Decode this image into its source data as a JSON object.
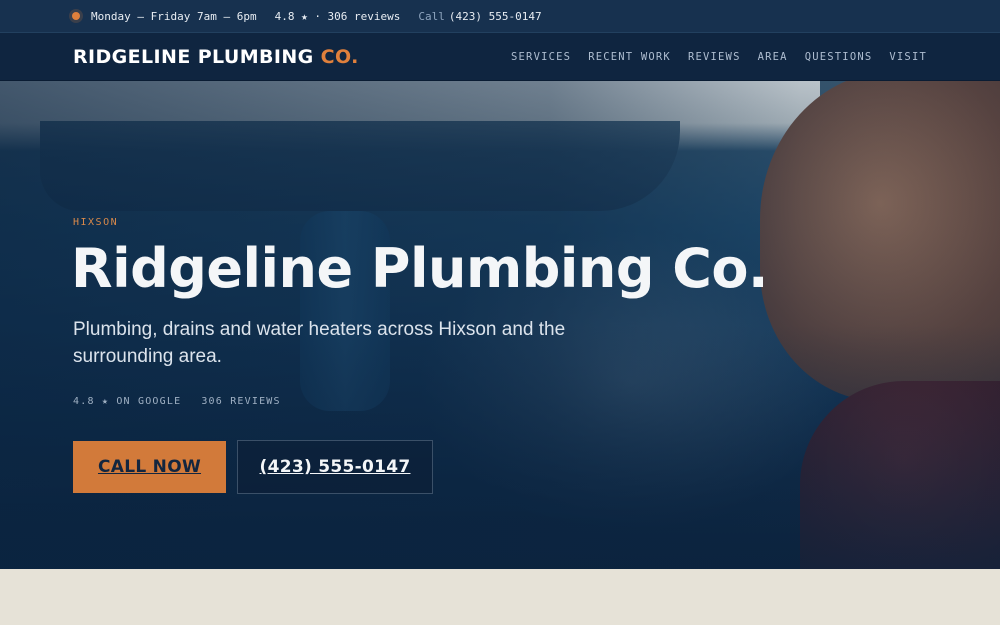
{
  "topbar": {
    "hours": "Monday – Friday 7am – 6pm",
    "rating": "4.8 ★ · 306 reviews",
    "call_label": "Call",
    "call_phone": "(423) 555-0147",
    "status_icon": "open-status-dot-icon"
  },
  "brand": {
    "name_main": "RIDGELINE PLUMBING",
    "name_accent": "CO."
  },
  "nav": {
    "items": [
      "SERVICES",
      "RECENT WORK",
      "REVIEWS",
      "AREA",
      "QUESTIONS",
      "VISIT"
    ]
  },
  "hero": {
    "eyebrow": "HIXSON",
    "title": "Ridgeline Plumbing Co.",
    "subtitle": "Plumbing, drains and water heaters across Hixson and the surrounding area.",
    "stat_rating": "4.8 ★ ON GOOGLE",
    "stat_reviews": "306 REVIEWS",
    "cta_primary": "CALL NOW",
    "cta_secondary": "(423) 555-0147"
  },
  "colors": {
    "accent": "#d27a3a",
    "navy": "#0f2540",
    "topbar": "#17314f",
    "below_bg": "#e6e2d7"
  }
}
